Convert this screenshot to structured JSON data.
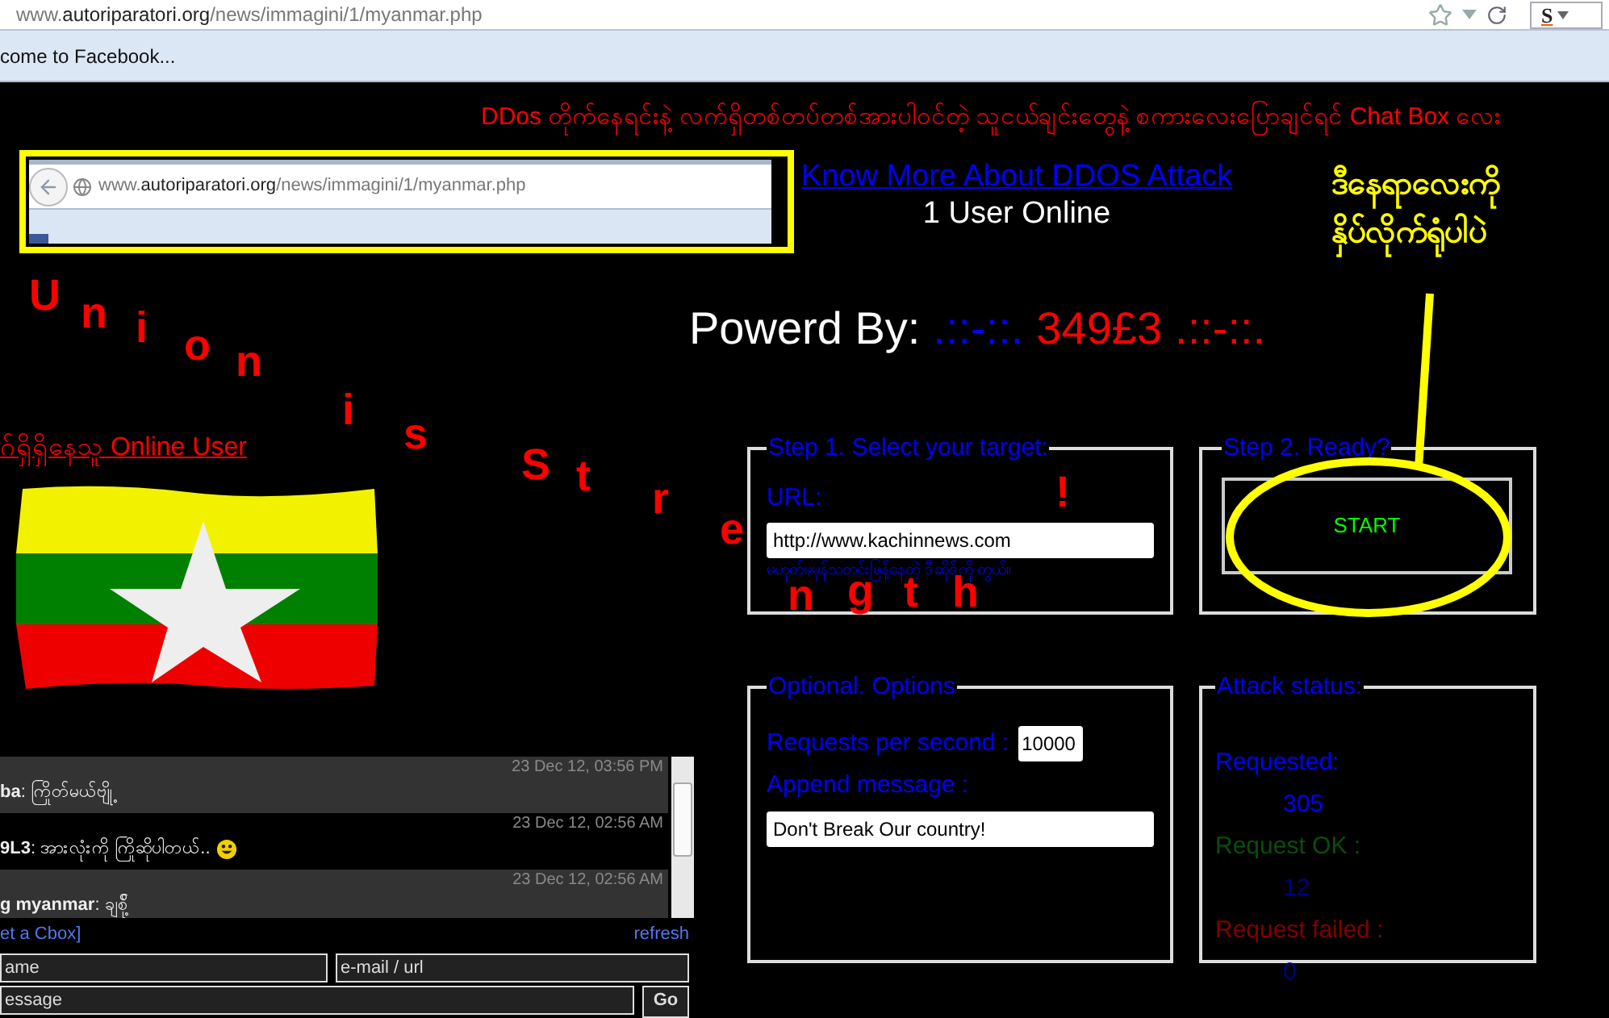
{
  "browser": {
    "url_prefix": "www.",
    "url_domain": "autoriparatori.org",
    "url_path": "/news/immagini/1/myanmar.php",
    "search_logo": "S",
    "bookmark": "come to Facebook..."
  },
  "marquee": "DDos တိုက်နေရင်းနဲ့ လက်ရှိတစ်တပ်တစ်အားပါဝင်တဲ့ သူငယ်ချင်းတွေနဲ့ စကားလေးပြောချင်ရင် Chat Box လေး",
  "inset": {
    "url_prefix": "www.",
    "url_domain": "autoriparatori.org",
    "url_path": "/news/immagini/1/myanmar.php"
  },
  "about_link": "Know More About DDOS Attack",
  "users_online": "1 User Online",
  "annotation": [
    "ဒီနေရာလေးကို",
    "နှိပ်လိုက်ရုံပါပဲ"
  ],
  "powered": {
    "label": "Powerd By:",
    "deco_left": ".::-::.",
    "name": "349£3",
    "deco_right": ".::-::."
  },
  "slogan_letters": [
    "U",
    "n",
    "i",
    "o",
    "n",
    "i",
    "s",
    "S",
    "t",
    "r",
    "e",
    "n",
    "g",
    "t",
    "h",
    "!"
  ],
  "online_heading": "ဂ်ရှိရှိနေသူ Online User",
  "chat": {
    "messages": [
      {
        "time": "23 Dec 12, 03:56 PM",
        "text": "**ba**: ကြိုတ်မယ်ဗျို့",
        "smiley": false
      },
      {
        "time": "23 Dec 12, 02:56 AM",
        "text": "**9L3**: အားလုံးကို ကြိုဆိုပါတယ်..",
        "smiley": true
      },
      {
        "time": "23 Dec 12, 02:56 AM",
        "text": "**g myanmar**: ချစ်ို့",
        "smiley": false
      }
    ],
    "get_link": "et a Cbox]",
    "refresh": "refresh",
    "name_field": "ame",
    "email_field": "e-mail / url",
    "message_field": "essage",
    "go": "Go"
  },
  "step1": {
    "legend": "Step 1. Select your target:",
    "url_label": "URL:",
    "url_value": "http://www.kachinnews.com",
    "hint": "မဟုတ်မမှန်သတင်းဖြန့်နေတဲ့ ဒီဆိုဒ်ကို တွယ်။"
  },
  "step2": {
    "legend": "Step 2. Ready?",
    "start": "START"
  },
  "options": {
    "legend": "Optional. Options",
    "rps_label": "Requests per second :",
    "rps_value": "10000",
    "append_label": "Append message :",
    "append_value": "Don't Break Our country!"
  },
  "status": {
    "legend": "Attack status:",
    "items": [
      {
        "kind": "requested",
        "label": "Requested:",
        "value": "305"
      },
      {
        "kind": "ok",
        "label": "Request OK :",
        "value": "12"
      },
      {
        "kind": "failed",
        "label": "Request failed :",
        "value": "0"
      }
    ]
  }
}
